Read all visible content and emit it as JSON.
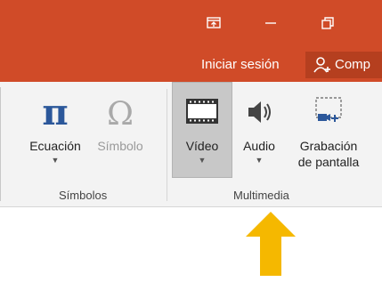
{
  "titlebar": {
    "ribbon_display_icon": "ribbon-display-options-icon",
    "minimize_icon": "minimize-icon",
    "restore_icon": "restore-icon",
    "color": "#d04b28"
  },
  "account": {
    "signin_label": "Iniciar sesión",
    "share_label": "Comp",
    "share_icon": "add-person-icon"
  },
  "ribbon": {
    "groups": [
      {
        "label": "Símbolos",
        "commands": [
          {
            "label": "Ecuación",
            "icon": "pi-icon",
            "has_dropdown": true,
            "enabled": true
          },
          {
            "label": "Símbolo",
            "icon": "omega-icon",
            "has_dropdown": false,
            "enabled": false
          }
        ]
      },
      {
        "label": "Multimedia",
        "commands": [
          {
            "label": "Vídeo",
            "icon": "film-icon",
            "has_dropdown": true,
            "selected": true
          },
          {
            "label": "Audio",
            "icon": "speaker-icon",
            "has_dropdown": true
          },
          {
            "label_line1": "Grabación",
            "label_line2": "de pantalla",
            "icon": "screen-recording-icon",
            "has_dropdown": false
          }
        ]
      }
    ]
  },
  "annotation": {
    "icon": "up-arrow-icon",
    "color": "#f5b800"
  }
}
